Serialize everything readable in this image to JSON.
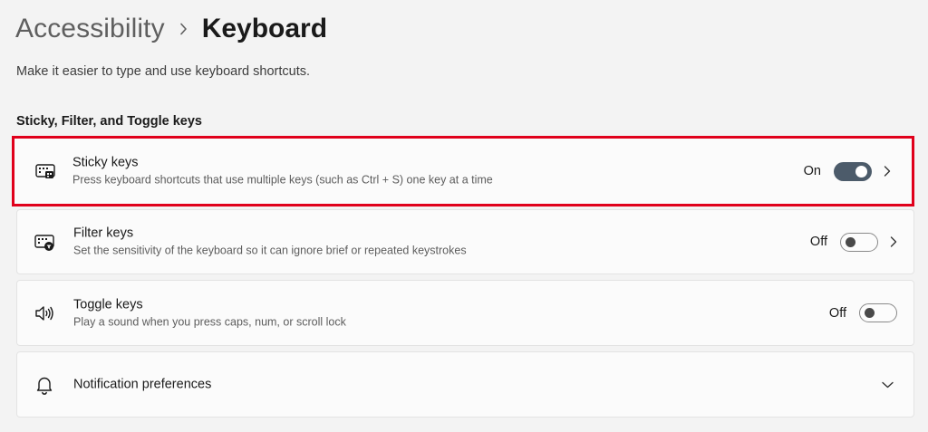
{
  "breadcrumb": {
    "parent": "Accessibility",
    "current": "Keyboard"
  },
  "subtitle": "Make it easier to type and use keyboard shortcuts.",
  "section_title": "Sticky, Filter, and Toggle keys",
  "settings": [
    {
      "title": "Sticky keys",
      "description": "Press keyboard shortcuts that use multiple keys (such as Ctrl + S) one key at a time",
      "state_label": "On",
      "toggle_on": true,
      "icon": "sticky-keys-icon",
      "has_chevron": true
    },
    {
      "title": "Filter keys",
      "description": "Set the sensitivity of the keyboard so it can ignore brief or repeated keystrokes",
      "state_label": "Off",
      "toggle_on": false,
      "icon": "filter-keys-icon",
      "has_chevron": true
    },
    {
      "title": "Toggle keys",
      "description": "Play a sound when you press caps, num, or scroll lock",
      "state_label": "Off",
      "toggle_on": false,
      "icon": "speaker-icon",
      "has_chevron": false
    },
    {
      "title": "Notification preferences",
      "icon": "bell-icon",
      "expandable": true
    }
  ],
  "colors": {
    "background": "#f3f3f3",
    "card": "#fbfbfb",
    "toggle_on": "#4c5b6a",
    "highlight_border": "#e0001b"
  }
}
